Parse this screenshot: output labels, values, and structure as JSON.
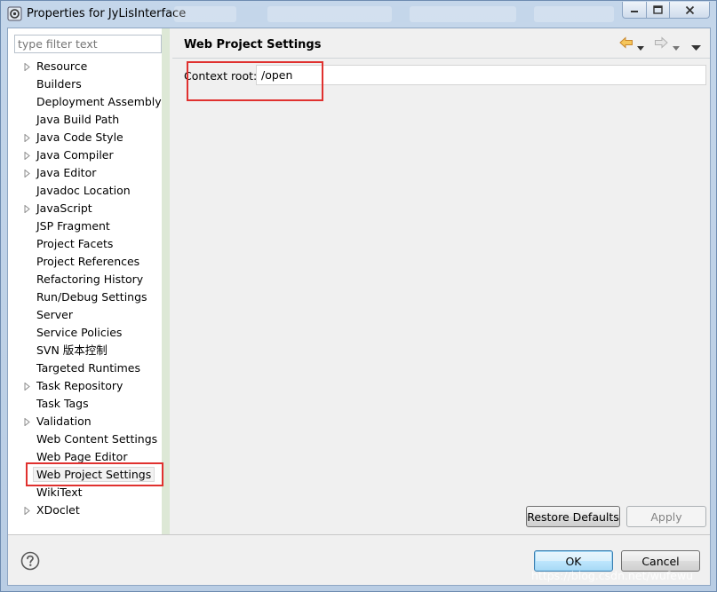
{
  "window": {
    "title": "Properties for JyLisInterface"
  },
  "filter": {
    "placeholder": "type filter text"
  },
  "tree": {
    "items": [
      {
        "label": "Resource",
        "expandable": true
      },
      {
        "label": "Builders",
        "expandable": false
      },
      {
        "label": "Deployment Assembly",
        "expandable": false
      },
      {
        "label": "Java Build Path",
        "expandable": false
      },
      {
        "label": "Java Code Style",
        "expandable": true
      },
      {
        "label": "Java Compiler",
        "expandable": true
      },
      {
        "label": "Java Editor",
        "expandable": true
      },
      {
        "label": "Javadoc Location",
        "expandable": false
      },
      {
        "label": "JavaScript",
        "expandable": true
      },
      {
        "label": "JSP Fragment",
        "expandable": false
      },
      {
        "label": "Project Facets",
        "expandable": false
      },
      {
        "label": "Project References",
        "expandable": false
      },
      {
        "label": "Refactoring History",
        "expandable": false
      },
      {
        "label": "Run/Debug Settings",
        "expandable": false
      },
      {
        "label": "Server",
        "expandable": false
      },
      {
        "label": "Service Policies",
        "expandable": false
      },
      {
        "label": "SVN 版本控制",
        "expandable": false
      },
      {
        "label": "Targeted Runtimes",
        "expandable": false
      },
      {
        "label": "Task Repository",
        "expandable": true
      },
      {
        "label": "Task Tags",
        "expandable": false
      },
      {
        "label": "Validation",
        "expandable": true
      },
      {
        "label": "Web Content Settings",
        "expandable": false
      },
      {
        "label": "Web Page Editor",
        "expandable": false
      },
      {
        "label": "Web Project Settings",
        "expandable": false,
        "selected": true
      },
      {
        "label": "WikiText",
        "expandable": false
      },
      {
        "label": "XDoclet",
        "expandable": true
      }
    ]
  },
  "page": {
    "title": "Web Project Settings",
    "context_root_label": "Context root:",
    "context_root_value": "/open",
    "restore_defaults": "Restore Defaults",
    "apply": "Apply"
  },
  "footer": {
    "ok": "OK",
    "cancel": "Cancel"
  },
  "watermark": "https://blog.csdn.net/wufewu",
  "colors": {
    "highlight": "#e0312f",
    "nav_back": "#e8a33a",
    "window_frame": "#b9cde4"
  },
  "icons": {
    "app": "eclipse-properties-icon",
    "back": "back-arrow-icon",
    "forward": "forward-arrow-icon",
    "menu": "view-menu-icon",
    "help": "help-icon"
  }
}
